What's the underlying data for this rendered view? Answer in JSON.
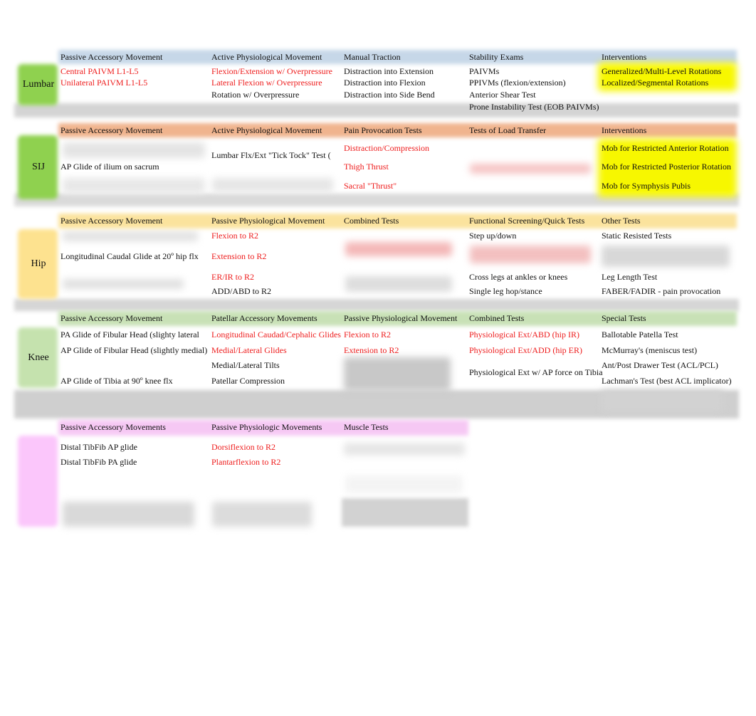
{
  "colors": {
    "lumbar_header": "#c6d7e8",
    "sij_header": "#f0b48e",
    "hip_header": "#fbe39d",
    "knee_header": "#c8e1b6",
    "ankle_header": "#f6c8f4",
    "label_green": "#8fd14f",
    "label_yellow": "#fde28f",
    "label_light_green": "#c5e2ae",
    "label_pink": "#fbc6fb",
    "highlight": "#f7f700",
    "red_text": "#ee1c1c"
  },
  "sections": [
    {
      "label": "Lumbar",
      "headers": [
        "Passive Accessory Movement",
        "Active Physiological Movement",
        "Manual Traction",
        "Stability Exams",
        "Interventions"
      ],
      "columns": [
        [
          {
            "t": "Central PAIVM L1-L5",
            "red": true
          },
          {
            "t": "Unilateral PAIVM L1-L5",
            "red": true
          }
        ],
        [
          {
            "t": "Flexion/Extension w/ Overpressure",
            "red": true
          },
          {
            "t": "Lateral Flexion w/ Overpressure",
            "red": true
          },
          {
            "t": "Rotation w/ Overpressure"
          }
        ],
        [
          {
            "t": "Distraction into Extension"
          },
          {
            "t": "Distraction into Flexion"
          },
          {
            "t": "Distraction into Side Bend"
          }
        ],
        [
          {
            "t": "PAIVMs"
          },
          {
            "t": "PPIVMs (flexion/extension)"
          },
          {
            "t": "Anterior Shear Test"
          },
          {
            "t": "Prone Instability Test (EOB PAIVMs)"
          }
        ],
        [
          {
            "t": "Generalized/Multi-Level Rotations"
          },
          {
            "t": "Localized/Segmental Rotations"
          }
        ]
      ]
    },
    {
      "label": "SIJ",
      "headers": [
        "Passive Accessory Movement",
        "Active Physiological Movement",
        "Pain Provocation Tests",
        "Tests of Load Transfer",
        "Interventions"
      ],
      "columns": [
        [
          null,
          null,
          {
            "t": "AP Glide of ilium on sacrum"
          }
        ],
        [
          null,
          {
            "t": "Lumbar Flx/Ext \"Tick Tock\" Test ("
          }
        ],
        [
          {
            "t": "Distraction/Compression",
            "red": true
          },
          null,
          {
            "t": "Thigh Thrust",
            "red": true
          },
          {
            "t": "Sacral \"Thrust\"",
            "red": true
          }
        ],
        [],
        [
          {
            "t": "Mob for Restricted Anterior Rotation"
          },
          null,
          {
            "t": "Mob for Restricted Posterior Rotation"
          },
          {
            "t": "Mob for Symphysis Pubis"
          }
        ]
      ]
    },
    {
      "label": "Hip",
      "headers": [
        "Passive Accessory Movement",
        "Passive Physiological Movement",
        "Combined Tests",
        "Functional Screening/Quick Tests",
        "Other Tests"
      ],
      "columns": [
        [
          null,
          {
            "t": "Longitudinal Caudal Glide at 20º hip flx"
          }
        ],
        [
          {
            "t": "Flexion to R2",
            "red": true
          },
          {
            "t": "Extension to R2",
            "red": true
          },
          {
            "t": "ER/IR to R2",
            "red": true
          },
          {
            "t": "ADD/ABD to R2"
          }
        ],
        [],
        [
          {
            "t": "Step up/down"
          },
          null,
          {
            "t": "Cross legs at ankles or knees"
          },
          {
            "t": "Single leg hop/stance"
          }
        ],
        [
          {
            "t": "Static Resisted Tests"
          },
          null,
          {
            "t": "Leg Length Test"
          },
          {
            "t": "FABER/FADIR - pain provocation"
          }
        ]
      ]
    },
    {
      "label": "Knee",
      "headers": [
        "Passive Accessory Movement",
        "Patellar Accessory Movements",
        "Passive Physiological Movement",
        "Combined Tests",
        "Special Tests"
      ],
      "columns": [
        [
          {
            "t": "PA Glide of Fibular Head (slighty lateral"
          },
          {
            "t": "AP Glide of Fibular Head (slightly medial)"
          },
          null,
          null,
          {
            "t": "AP Glide of Tibia at 90º knee flx"
          }
        ],
        [
          {
            "t": "Longitudinal Caudad/Cephalic Glides",
            "red": true
          },
          {
            "t": "Medial/Lateral Glides",
            "red": true
          },
          {
            "t": "Medial/Lateral Tilts"
          },
          null,
          {
            "t": "Patellar Compression"
          }
        ],
        [
          {
            "t": "Flexion to R2",
            "red": true
          },
          {
            "t": "Extension to R2",
            "red": true
          }
        ],
        [
          {
            "t": "Physiological Ext/ABD (hip IR)",
            "red": true
          },
          {
            "t": "Physiological Ext/ADD (hip ER)",
            "red": true
          },
          null,
          {
            "t": "Physiological Ext w/ AP force on Tibia"
          }
        ],
        [
          {
            "t": "Ballotable Patella Test"
          },
          {
            "t": "McMurray's (meniscus test)"
          },
          {
            "t": "Ant/Post Drawer Test (ACL/PCL)"
          },
          null,
          {
            "t": "Lachman's Test (best ACL implicator)"
          }
        ]
      ]
    },
    {
      "label": "",
      "headers": [
        "Passive Accessory Movements",
        "Passive Physiologic Movements",
        "Muscle Tests"
      ],
      "columns": [
        [
          {
            "t": "Distal TibFib AP glide"
          },
          {
            "t": "Distal TibFib PA glide"
          }
        ],
        [
          {
            "t": "Dorsiflexion to R2",
            "red": true
          },
          {
            "t": "Plantarflexion to R2",
            "red": true
          }
        ],
        []
      ]
    }
  ]
}
